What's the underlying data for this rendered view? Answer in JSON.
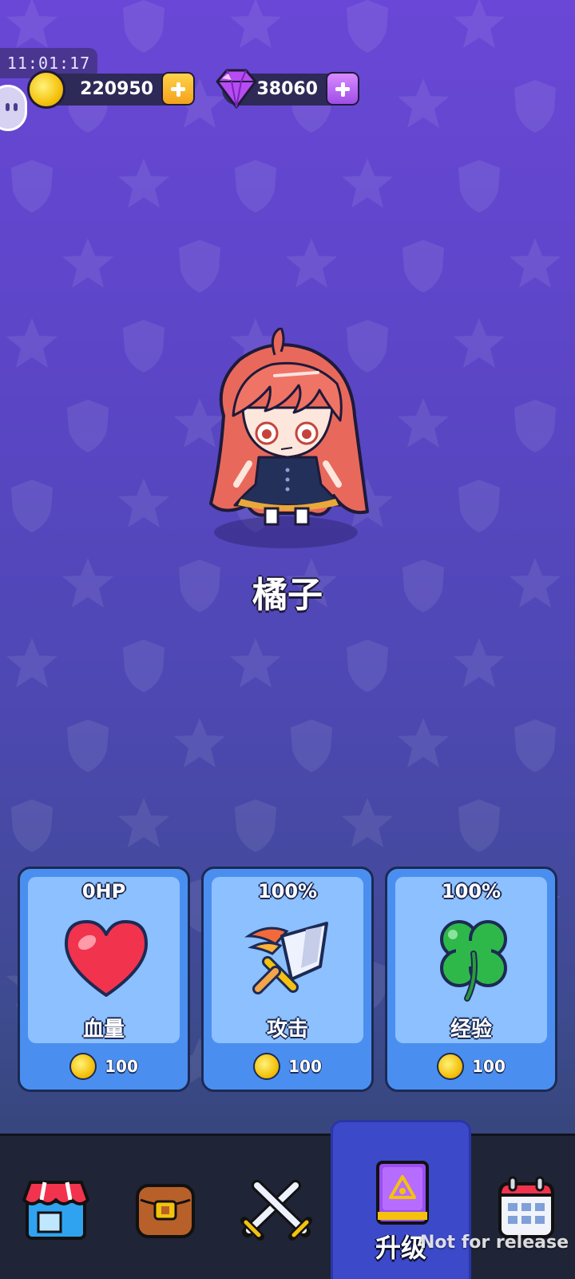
{
  "status": {
    "time": "11:01:17"
  },
  "resources": {
    "gold": {
      "value": "220950",
      "icon": "coin-icon"
    },
    "gems": {
      "value": "38060",
      "icon": "gem-icon"
    }
  },
  "character": {
    "name": "橘子"
  },
  "upgrades": [
    {
      "stat": "0HP",
      "title": "血量",
      "cost": "100",
      "icon": "heart-icon"
    },
    {
      "stat": "100%",
      "title": "攻击",
      "cost": "100",
      "icon": "sword-icon"
    },
    {
      "stat": "100%",
      "title": "经验",
      "cost": "100",
      "icon": "clover-icon"
    }
  ],
  "nav": {
    "items": [
      {
        "id": "shop",
        "icon": "shop-icon"
      },
      {
        "id": "bag",
        "icon": "backpack-icon"
      },
      {
        "id": "battle",
        "icon": "crossed-swords-icon"
      },
      {
        "id": "upgrade",
        "icon": "spellbook-icon",
        "label": "升级",
        "active": true
      },
      {
        "id": "events",
        "icon": "calendar-icon"
      }
    ]
  },
  "watermark": "Not for release",
  "colors": {
    "bg_top": "#6a47d6",
    "bg_bottom": "#2f3f66",
    "card": "#4a8ff0",
    "nav_active": "#3c49c9"
  }
}
